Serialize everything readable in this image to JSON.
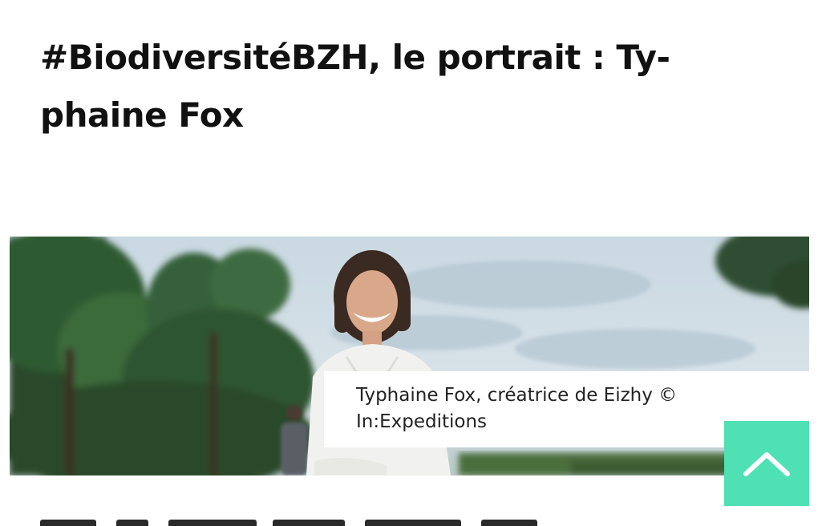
{
  "article": {
    "title": "#BiodiversitéBZH, le portrait : Ty-phaine Fox",
    "title_line1": "#BiodiversitéBZH, le portrait : Ty-",
    "title_line2": "phaine Fox",
    "hero": {
      "image_icon": "portrait-photo",
      "caption_line1": "Typhaine Fox, créatrice de Eizhy ©",
      "caption_line2": "In:Expeditions"
    }
  },
  "scroll_top": {
    "icon": "chevron-up-icon",
    "color": "#4fe0b4"
  }
}
